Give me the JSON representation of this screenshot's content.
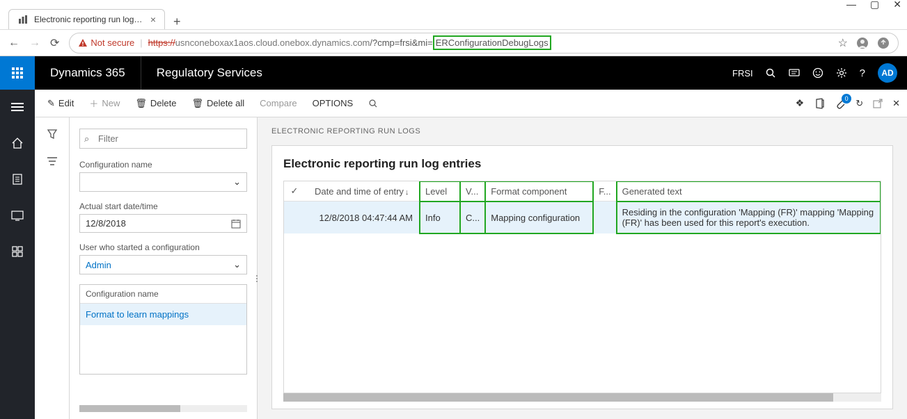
{
  "browser": {
    "tab_title": "Electronic reporting run logs -- R",
    "security_label": "Not secure",
    "url_scheme": "https://",
    "url_host": "usnconeboxax1aos.cloud.onebox.dynamics.com",
    "url_query": "/?cmp=frsi&mi=",
    "url_highlight": "ERConfigurationDebugLogs"
  },
  "topbar": {
    "brand": "Dynamics 365",
    "module": "Regulatory Services",
    "company": "FRSI",
    "avatar": "AD"
  },
  "cmdbar": {
    "edit": "Edit",
    "new": "New",
    "delete": "Delete",
    "delete_all": "Delete all",
    "compare": "Compare",
    "options": "OPTIONS",
    "badge": "0"
  },
  "filter": {
    "placeholder": "Filter",
    "config_name_label": "Configuration name",
    "config_name_value": "",
    "start_date_label": "Actual start date/time",
    "start_date_value": "12/8/2018",
    "user_label": "User who started a configuration",
    "user_value": "Admin",
    "list_header": "Configuration name",
    "list_item": "Format to learn mappings"
  },
  "detail": {
    "heading": "ELECTRONIC REPORTING RUN LOGS",
    "card_title": "Electronic reporting run log entries",
    "columns": {
      "date": "Date and time of entry",
      "level": "Level",
      "v": "V...",
      "format": "Format component",
      "f": "F...",
      "gen": "Generated text"
    },
    "row": {
      "date": "12/8/2018 04:47:44 AM",
      "level": "Info",
      "v": "C...",
      "format": "Mapping configuration",
      "f": "",
      "gen": "Residing in the configuration 'Mapping (FR)' mapping 'Mapping (FR)' has been used for this report's execution."
    }
  }
}
